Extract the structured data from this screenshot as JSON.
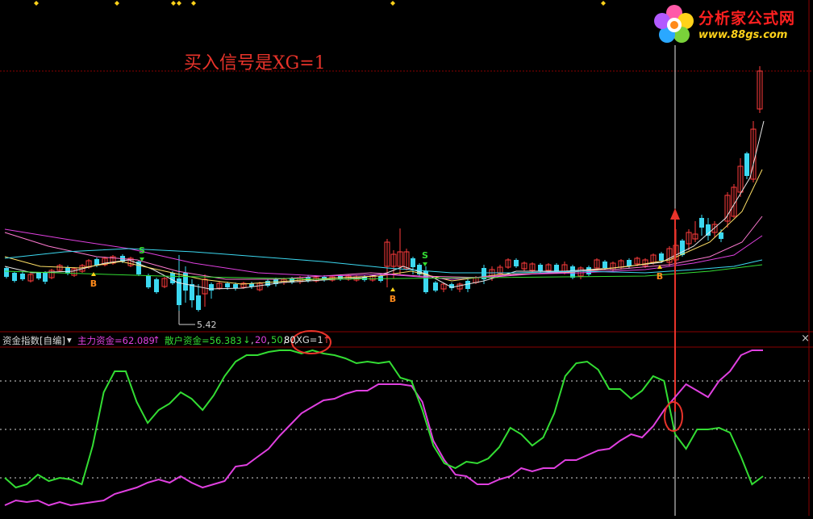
{
  "logo": {
    "title": "分析家公式网",
    "url": "www.88gs.com"
  },
  "annotation": "买入信号是XG=1",
  "indicator": {
    "name": "资金指数[自编]",
    "main_label": "主力资金=62.089",
    "main_arrow": "↑",
    "retail_label": "散户资金=56.383",
    "retail_arrow": "↓",
    "levels_prefix": ",",
    "level_20": "20",
    "level_50": "50",
    "level_80": "80",
    "xg_label": "XG=1",
    "xg_arrow": "↑",
    "close": "×"
  },
  "price_min_label": "5.42",
  "signals": [
    "B",
    "S",
    "B",
    "S",
    "B"
  ],
  "colors": {
    "background": "#000000",
    "up_candle": "#ff3c3c",
    "down_candle": "#3cd8f0",
    "main_fund": "#e040e0",
    "retail_fund": "#33dd33",
    "annotation": "#e8332a",
    "grid": "#8a0000"
  },
  "chart_data": [
    {
      "type": "line",
      "title": "",
      "description_series": "moving averages over candles",
      "series": [
        {
          "values": [
            0.92,
            0.9,
            0.87,
            0.84,
            0.82,
            0.81,
            0.81,
            0.8,
            0.8,
            0.79,
            0.79,
            0.79,
            0.78,
            0.78,
            0.78,
            0.78,
            0.79,
            0.79,
            0.79,
            0.8,
            0.83,
            0.9,
            1.05,
            1.3
          ]
        },
        {
          "values": [
            0.95,
            0.91,
            0.86,
            0.82,
            0.8,
            0.77,
            0.76,
            0.75,
            0.75,
            0.76,
            0.78,
            0.8,
            0.8,
            0.77,
            0.75,
            0.74,
            0.75,
            0.76,
            0.77,
            0.78,
            0.84,
            0.98,
            1.25,
            1.75
          ]
        }
      ]
    },
    {
      "type": "line",
      "title": "",
      "ylim": [
        0,
        100
      ],
      "levels": [
        20,
        50,
        80
      ],
      "series": [
        {
          "name": "主力资金",
          "values": [
            3,
            6,
            5,
            6,
            3,
            5,
            3,
            4,
            5,
            6,
            10,
            12,
            14,
            17,
            19,
            17,
            21,
            17,
            14,
            16,
            18,
            27,
            28,
            33,
            38,
            46,
            53,
            60,
            64,
            68,
            69,
            72,
            74,
            74,
            78,
            78,
            78,
            77,
            67,
            43,
            31,
            22,
            21,
            16,
            16,
            19,
            21,
            26,
            24,
            26,
            26,
            31,
            31,
            34,
            37,
            38,
            43,
            47,
            45,
            52,
            62,
            70,
            78,
            74,
            70,
            80,
            86,
            96,
            99,
            99
          ]
        },
        {
          "name": "散户资金",
          "values": [
            20,
            14,
            16,
            22,
            18,
            20,
            19,
            16,
            40,
            73,
            86,
            86,
            67,
            54,
            62,
            66,
            73,
            69,
            62,
            71,
            83,
            92,
            96,
            96,
            98,
            99,
            99,
            97,
            99,
            97,
            96,
            94,
            91,
            92,
            91,
            92,
            82,
            80,
            62,
            40,
            29,
            26,
            30,
            29,
            32,
            39,
            51,
            47,
            40,
            45,
            60,
            83,
            91,
            92,
            87,
            75,
            75,
            69,
            74,
            83,
            80,
            47,
            38,
            50,
            50,
            51,
            48,
            33,
            16,
            21
          ]
        }
      ]
    }
  ]
}
